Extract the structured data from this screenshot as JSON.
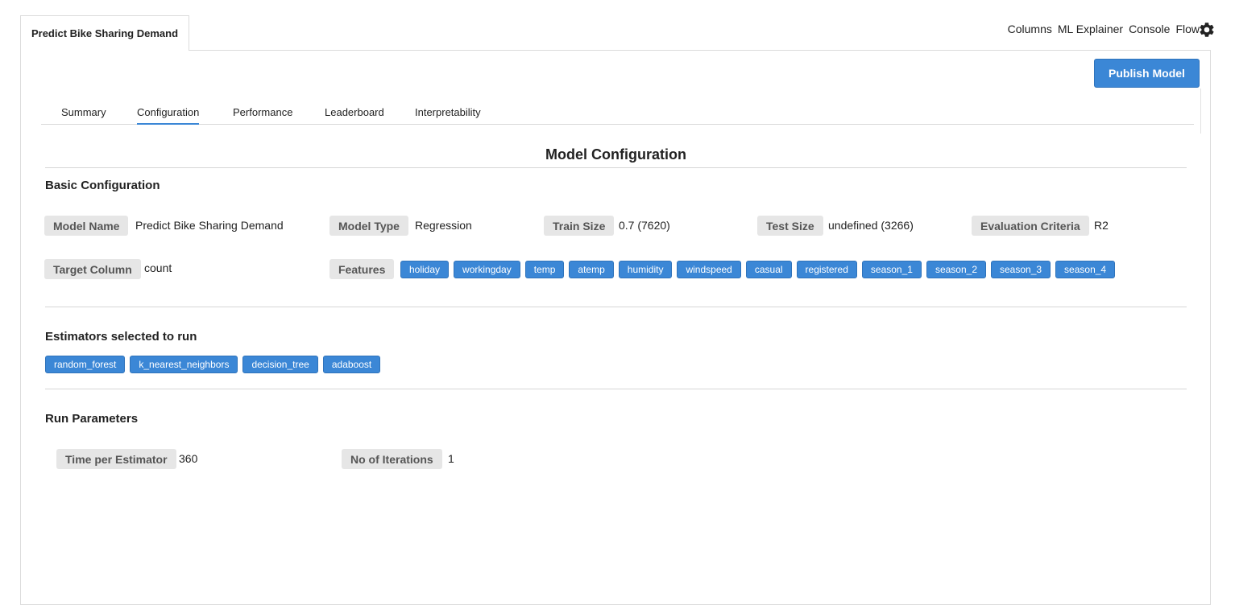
{
  "doc_tab": "Predict Bike Sharing Demand",
  "top_links": [
    "Columns",
    "ML Explainer",
    "Console",
    "Flow"
  ],
  "icons": {
    "settings": "gear-icon"
  },
  "publish_button": "Publish Model",
  "tabs": [
    "Summary",
    "Configuration",
    "Performance",
    "Leaderboard",
    "Interpretability"
  ],
  "active_tab": "Configuration",
  "page_heading": "Model Configuration",
  "basic": {
    "title": "Basic Configuration",
    "model_name_label": "Model Name",
    "model_name_value": "Predict Bike Sharing Demand",
    "model_type_label": "Model Type",
    "model_type_value": "Regression",
    "train_size_label": "Train Size",
    "train_size_value": "0.7 (7620)",
    "test_size_label": "Test Size",
    "test_size_value": "undefined (3266)",
    "eval_label": "Evaluation Criteria",
    "eval_value": "R2",
    "target_label": "Target Column",
    "target_value": "count",
    "features_label": "Features",
    "features": [
      "holiday",
      "workingday",
      "temp",
      "atemp",
      "humidity",
      "windspeed",
      "casual",
      "registered",
      "season_1",
      "season_2",
      "season_3",
      "season_4"
    ]
  },
  "estimators": {
    "title": "Estimators selected to run",
    "items": [
      "random_forest",
      "k_nearest_neighbors",
      "decision_tree",
      "adaboost"
    ]
  },
  "run_params": {
    "title": "Run Parameters",
    "time_label": "Time per Estimator",
    "time_value": "360",
    "iter_label": "No of Iterations",
    "iter_value": "1"
  },
  "colors": {
    "accent": "#3b87d6",
    "label_bg": "#e6e6e6"
  }
}
